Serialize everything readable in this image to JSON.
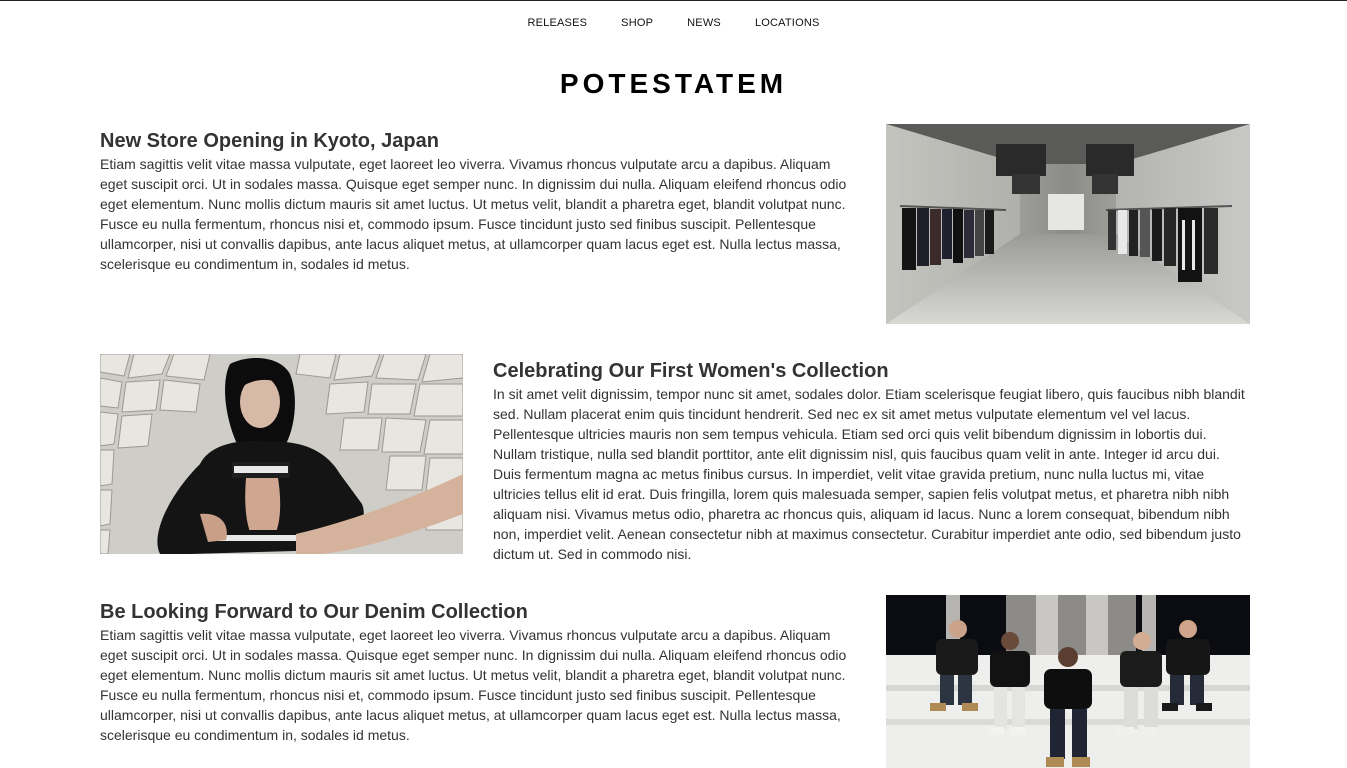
{
  "nav": {
    "items": [
      "RELEASES",
      "SHOP",
      "NEWS",
      "LOCATIONS"
    ]
  },
  "brand": "POTESTATEM",
  "articles": [
    {
      "title": "New Store Opening in Kyoto, Japan",
      "body": "Etiam sagittis velit vitae massa vulputate, eget laoreet leo viverra. Vivamus rhoncus vulputate arcu a dapibus. Aliquam eget suscipit orci. Ut in sodales massa. Quisque eget semper nunc. In dignissim dui nulla. Aliquam eleifend rhoncus odio eget elementum. Nunc mollis dictum mauris sit amet luctus. Ut metus velit, blandit a pharetra eget, blandit volutpat nunc. Fusce eu nulla fermentum, rhoncus nisi et, commodo ipsum. Fusce tincidunt justo sed finibus suscipit. Pellentesque ullamcorper, nisi ut convallis dapibus, ante lacus aliquet metus, at ullamcorper quam lacus eget est. Nulla lectus massa, scelerisque eu condimentum in, sodales id metus."
    },
    {
      "title": "Celebrating Our First Women's Collection",
      "body": "In sit amet velit dignissim, tempor nunc sit amet, sodales dolor. Etiam scelerisque feugiat libero, quis faucibus nibh blandit sed. Nullam placerat enim quis tincidunt hendrerit. Sed nec ex sit amet metus vulputate elementum vel vel lacus. Pellentesque ultricies mauris non sem tempus vehicula. Etiam sed orci quis velit bibendum dignissim in lobortis dui. Nullam tristique, nulla sed blandit porttitor, ante elit dignissim nisl, quis faucibus quam velit in ante. Integer id arcu dui. Duis fermentum magna ac metus finibus cursus. In imperdiet, velit vitae gravida pretium, nunc nulla luctus mi, vitae ultricies tellus elit id erat. Duis fringilla, lorem quis malesuada semper, sapien felis volutpat metus, et pharetra nibh nibh aliquam nisi. Vivamus metus odio, pharetra ac rhoncus quis, aliquam id lacus. Nunc a lorem consequat, bibendum nibh non, imperdiet velit. Aenean consectetur nibh at maximus consectetur. Curabitur imperdiet ante odio, sed bibendum justo dictum ut. Sed in commodo nisi."
    },
    {
      "title": "Be Looking Forward to Our Denim Collection",
      "body": "Etiam sagittis velit vitae massa vulputate, eget laoreet leo viverra. Vivamus rhoncus vulputate arcu a dapibus. Aliquam eget suscipit orci. Ut in sodales massa. Quisque eget semper nunc. In dignissim dui nulla. Aliquam eleifend rhoncus odio eget elementum. Nunc mollis dictum mauris sit amet luctus. Ut metus velit, blandit a pharetra eget, blandit volutpat nunc. Fusce eu nulla fermentum, rhoncus nisi et, commodo ipsum. Fusce tincidunt justo sed finibus suscipit. Pellentesque ullamcorper, nisi ut convallis dapibus, ante lacus aliquet metus, at ullamcorper quam lacus eget est. Nulla lectus massa, scelerisque eu condimentum in, sodales id metus."
    }
  ]
}
